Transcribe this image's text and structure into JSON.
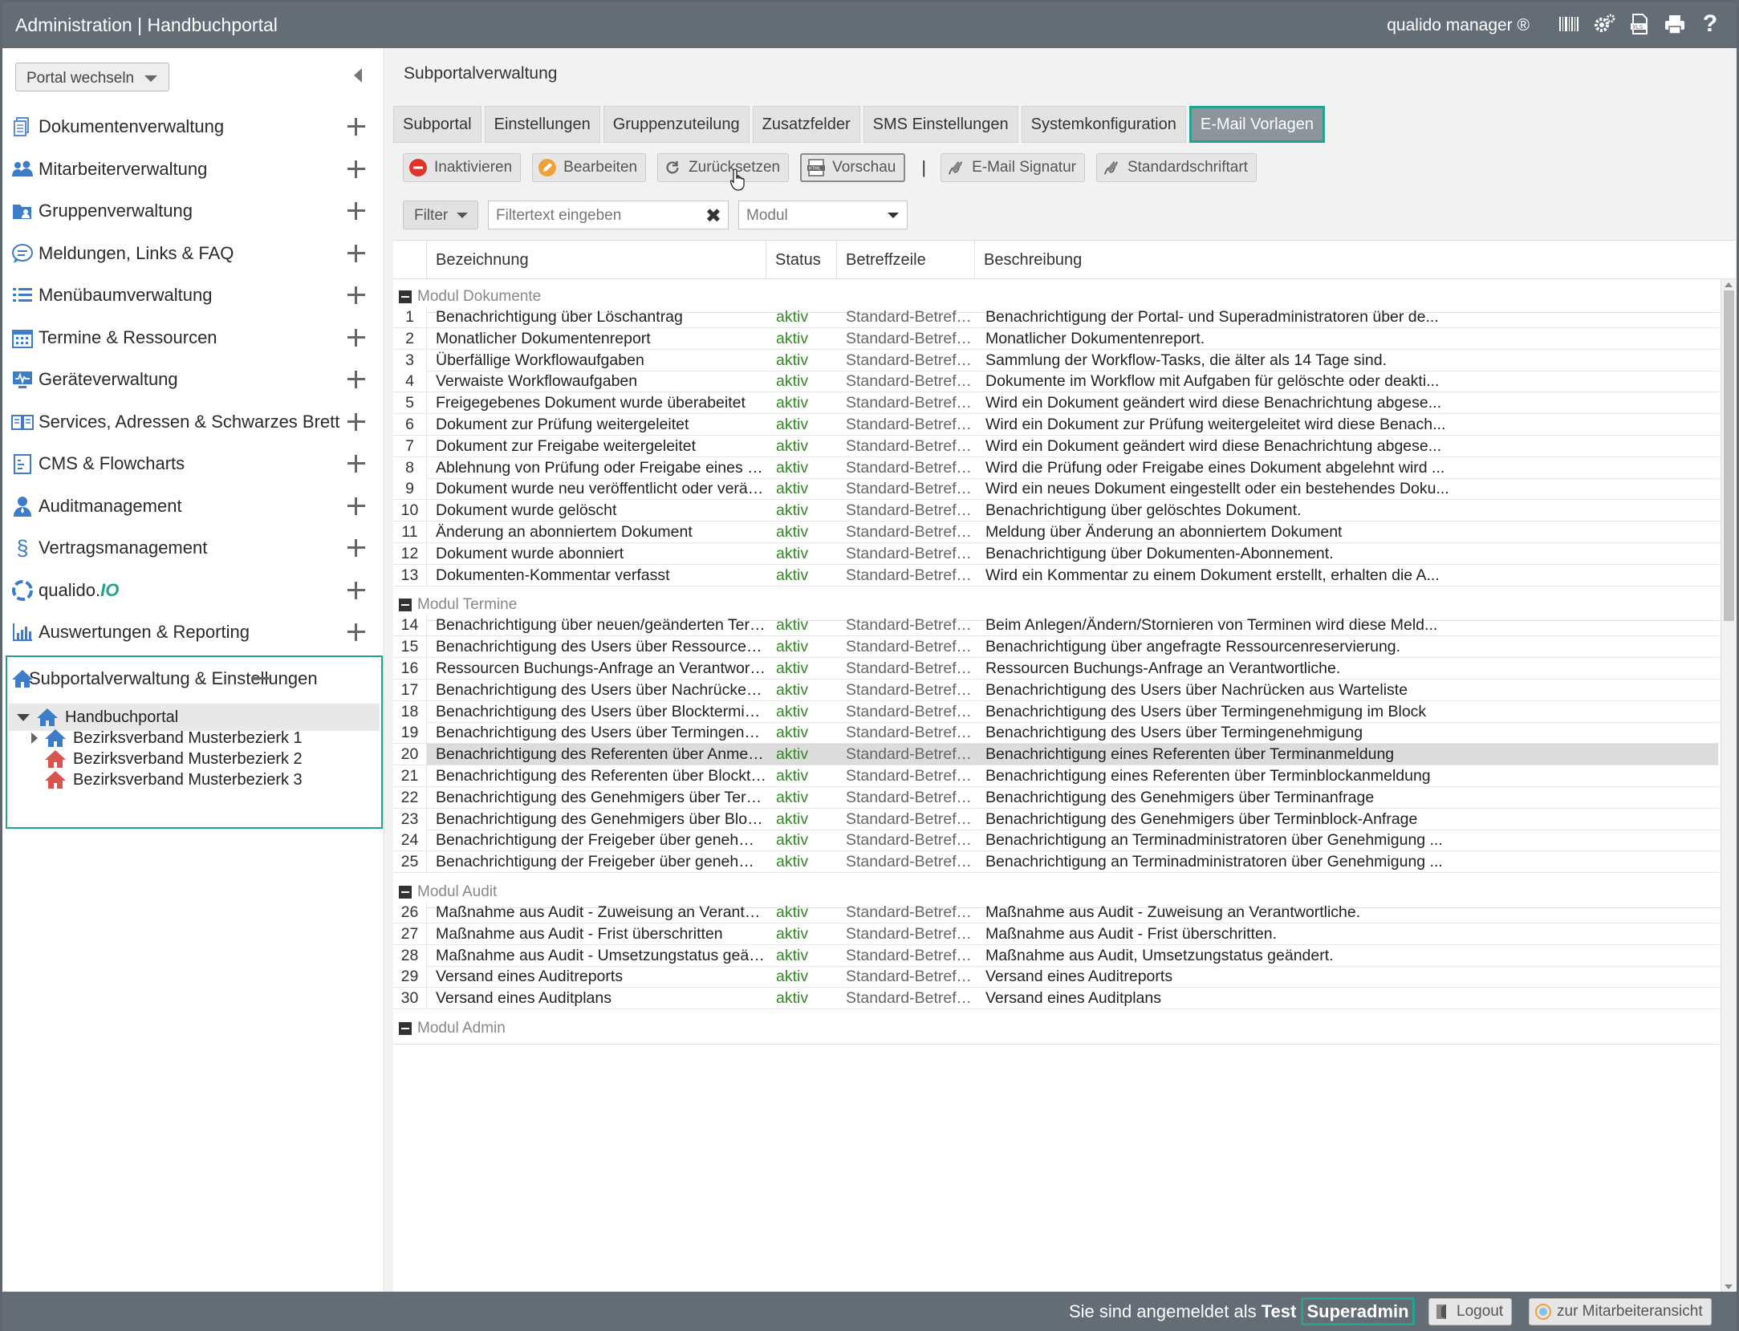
{
  "header": {
    "title": "Administration | Handbuchportal",
    "brand": "qualido manager ®"
  },
  "sidebar": {
    "portal_switch": "Portal wechseln",
    "items": [
      {
        "label": "Dokumentenverwaltung",
        "icon": "documents-icon"
      },
      {
        "label": "Mitarbeiterverwaltung",
        "icon": "users-icon"
      },
      {
        "label": "Gruppenverwaltung",
        "icon": "groups-icon"
      },
      {
        "label": "Meldungen, Links & FAQ",
        "icon": "chat-icon"
      },
      {
        "label": "Menübaumverwaltung",
        "icon": "list-icon"
      },
      {
        "label": "Termine & Ressourcen",
        "icon": "calendar-icon"
      },
      {
        "label": "Geräteverwaltung",
        "icon": "device-icon"
      },
      {
        "label": "Services, Adressen & Schwarzes Brett",
        "icon": "book-icon"
      },
      {
        "label": "CMS & Flowcharts",
        "icon": "cms-icon"
      },
      {
        "label": "Auditmanagement",
        "icon": "auditor-icon"
      },
      {
        "label": "Vertragsmanagement",
        "icon": "paragraph-icon"
      }
    ],
    "qualido_prefix": "qualido.",
    "qualido_suffix": "IO",
    "reporting": "Auswertungen & Reporting",
    "subportal": "Subportalverwaltung & Einstellungen",
    "tree": {
      "root": "Handbuchportal",
      "children": [
        "Bezirksverband Musterbezierk 1",
        "Bezirksverband Musterbezierk 2",
        "Bezirksverband Musterbezierk 3"
      ]
    }
  },
  "main": {
    "title": "Subportalverwaltung",
    "tabs": [
      "Subportal",
      "Einstellungen",
      "Gruppenzuteilung",
      "Zusatzfelder",
      "SMS Einstellungen",
      "Systemkonfiguration",
      "E-Mail Vorlagen"
    ],
    "active_tab": "E-Mail Vorlagen",
    "toolbar": {
      "deactivate": "Inaktivieren",
      "edit": "Bearbeiten",
      "reset": "Zurücksetzen",
      "preview": "Vorschau",
      "separator": "|",
      "signature": "E-Mail Signatur",
      "font": "Standardschriftart"
    },
    "filter": {
      "button": "Filter",
      "placeholder": "Filtertext eingeben",
      "clear": "✖",
      "module_placeholder": "Modul"
    },
    "columns": {
      "name": "Bezeichnung",
      "status": "Status",
      "subject": "Betreffzeile",
      "description": "Beschreibung"
    },
    "groups": [
      {
        "label": "Modul Dokumente",
        "rows": [
          {
            "n": "1",
            "name": "Benachrichtigung über Löschantrag",
            "status": "aktiv",
            "subject": "Standard-Betreffzeile",
            "desc": "Benachrichtigung der Portal- und Superadministratoren über de..."
          },
          {
            "n": "2",
            "name": "Monatlicher Dokumentenreport",
            "status": "aktiv",
            "subject": "Standard-Betreffzeile",
            "desc": "Monatlicher Dokumentenreport."
          },
          {
            "n": "3",
            "name": "Überfällige Workflowaufgaben",
            "status": "aktiv",
            "subject": "Standard-Betreffzeile",
            "desc": "Sammlung der Workflow-Tasks, die älter als 14 Tage sind."
          },
          {
            "n": "4",
            "name": "Verwaiste Workflowaufgaben",
            "status": "aktiv",
            "subject": "Standard-Betreffzeile",
            "desc": "Dokumente im Workflow mit Aufgaben für gelöschte oder deakti..."
          },
          {
            "n": "5",
            "name": "Freigegebenes Dokument wurde überabeitet",
            "status": "aktiv",
            "subject": "Standard-Betreffzeile",
            "desc": "Wird ein Dokument geändert wird diese Benachrichtung abgese..."
          },
          {
            "n": "6",
            "name": "Dokument zur Prüfung weitergeleitet",
            "status": "aktiv",
            "subject": "Standard-Betreffzeile",
            "desc": "Wird ein Dokument zur Prüfung weitergeleitet wird diese Benach..."
          },
          {
            "n": "7",
            "name": "Dokument zur Freigabe weitergeleitet",
            "status": "aktiv",
            "subject": "Standard-Betreffzeile",
            "desc": "Wird ein Dokument geändert wird diese Benachrichtung abgese..."
          },
          {
            "n": "8",
            "name": "Ablehnung von Prüfung oder Freigabe eines Dokumentes",
            "status": "aktiv",
            "subject": "Standard-Betreffzeile",
            "desc": "Wird die Prüfung oder Freigabe eines Dokument abgelehnt wird ..."
          },
          {
            "n": "9",
            "name": "Dokument wurde neu veröffentlicht oder verändert",
            "status": "aktiv",
            "subject": "Standard-Betreffzeile",
            "desc": "Wird ein neues Dokument eingestellt oder ein bestehendes Doku..."
          },
          {
            "n": "10",
            "name": "Dokument wurde gelöscht",
            "status": "aktiv",
            "subject": "Standard-Betreffzeile",
            "desc": "Benachrichtigung über gelöschtes Dokument."
          },
          {
            "n": "11",
            "name": "Änderung an abonniertem Dokument",
            "status": "aktiv",
            "subject": "Standard-Betreffzeile",
            "desc": "Meldung über Änderung an abonniertem Dokument"
          },
          {
            "n": "12",
            "name": "Dokument wurde abonniert",
            "status": "aktiv",
            "subject": "Standard-Betreffzeile",
            "desc": "Benachrichtigung über Dokumenten-Abonnement."
          },
          {
            "n": "13",
            "name": "Dokumenten-Kommentar verfasst",
            "status": "aktiv",
            "subject": "Standard-Betreffzeile",
            "desc": "Wird ein Kommentar zu einem Dokument erstellt, erhalten die A..."
          }
        ]
      },
      {
        "label": "Modul Termine",
        "rows": [
          {
            "n": "14",
            "name": "Benachrichtigung über neuen/geänderten Termin",
            "status": "aktiv",
            "subject": "Standard-Betreffzeile",
            "desc": "Beim Anlegen/Ändern/Stornieren von Terminen wird diese Meld..."
          },
          {
            "n": "15",
            "name": "Benachrichtigung des Users über Ressourcenreservierung",
            "status": "aktiv",
            "subject": "Standard-Betreffzeile",
            "desc": "Benachrichtigung über angefragte Ressourcenreservierung."
          },
          {
            "n": "16",
            "name": "Ressourcen Buchungs-Anfrage an Verantwortliche",
            "status": "aktiv",
            "subject": "Standard-Betreffzeile",
            "desc": "Ressourcen Buchungs-Anfrage an Verantwortliche."
          },
          {
            "n": "17",
            "name": "Benachrichtigung des Users über Nachrücken aus Warteli...",
            "status": "aktiv",
            "subject": "Standard-Betreffzeile",
            "desc": "Benachrichtigung des Users über Nachrücken aus Warteliste"
          },
          {
            "n": "18",
            "name": "Benachrichtigung des Users über Blocktermin-Genehmigu...",
            "status": "aktiv",
            "subject": "Standard-Betreffzeile",
            "desc": "Benachrichtigung des Users über Termingenehmigung im Block"
          },
          {
            "n": "19",
            "name": "Benachrichtigung des Users über Termingenehmigung",
            "status": "aktiv",
            "subject": "Standard-Betreffzeile",
            "desc": "Benachrichtigung des Users über Termingenehmigung"
          },
          {
            "n": "20",
            "name": "Benachrichtigung des Referenten über Anmeldung",
            "status": "aktiv",
            "subject": "Standard-Betreffzeile",
            "desc": "Benachrichtigung eines Referenten über Terminanmeldung",
            "selected": true
          },
          {
            "n": "21",
            "name": "Benachrichtigung des Referenten über Blockterin-Anmeld...",
            "status": "aktiv",
            "subject": "Standard-Betreffzeile",
            "desc": "Benachrichtigung eines Referenten über Terminblockanmeldung"
          },
          {
            "n": "22",
            "name": "Benachrichtigung des Genehmigers über Terminanfrage",
            "status": "aktiv",
            "subject": "Standard-Betreffzeile",
            "desc": "Benachrichtigung des Genehmigers über Terminanfrage"
          },
          {
            "n": "23",
            "name": "Benachrichtigung des Genehmigers über Blocktermin-Anf...",
            "status": "aktiv",
            "subject": "Standard-Betreffzeile",
            "desc": "Benachrichtigung des Genehmigers über Terminblock-Anfrage"
          },
          {
            "n": "24",
            "name": "Benachrichtigung der Freigeber über genehmigte Block-Te...",
            "status": "aktiv",
            "subject": "Standard-Betreffzeile",
            "desc": "Benachrichtigung an Terminadministratoren über Genehmigung ..."
          },
          {
            "n": "25",
            "name": "Benachrichtigung der Freigeber über genehmigte Termina...",
            "status": "aktiv",
            "subject": "Standard-Betreffzeile",
            "desc": "Benachrichtigung an Terminadministratoren über Genehmigung ..."
          }
        ]
      },
      {
        "label": "Modul Audit",
        "rows": [
          {
            "n": "26",
            "name": "Maßnahme aus Audit - Zuweisung an Verantwortliche",
            "status": "aktiv",
            "subject": "Standard-Betreffzeile",
            "desc": "Maßnahme aus Audit - Zuweisung an Verantwortliche."
          },
          {
            "n": "27",
            "name": "Maßnahme aus Audit - Frist überschritten",
            "status": "aktiv",
            "subject": "Standard-Betreffzeile",
            "desc": "Maßnahme aus Audit - Frist überschritten."
          },
          {
            "n": "28",
            "name": "Maßnahme aus Audit - Umsetzungstatus geändert",
            "status": "aktiv",
            "subject": "Standard-Betreffzeile",
            "desc": "Maßnahme aus Audit, Umsetzungstatus geändert."
          },
          {
            "n": "29",
            "name": "Versand eines Auditreports",
            "status": "aktiv",
            "subject": "Standard-Betreffzeile",
            "desc": "Versand eines Auditreports"
          },
          {
            "n": "30",
            "name": "Versand eines Auditplans",
            "status": "aktiv",
            "subject": "Standard-Betreffzeile",
            "desc": "Versand eines Auditplans"
          }
        ]
      },
      {
        "label": "Modul Admin",
        "rows": []
      }
    ]
  },
  "footer": {
    "login_prefix": "Sie sind angemeldet als",
    "user_first": "Test",
    "user_last": "Superadmin",
    "logout": "Logout",
    "employee_view": "zur Mitarbeiteransicht"
  },
  "colors": {
    "header_bg": "#646c76",
    "accent_teal": "#23a38e",
    "status_green": "#2f8a1f",
    "icon_blue": "#3d7cc9",
    "house_red": "#d9534f"
  }
}
